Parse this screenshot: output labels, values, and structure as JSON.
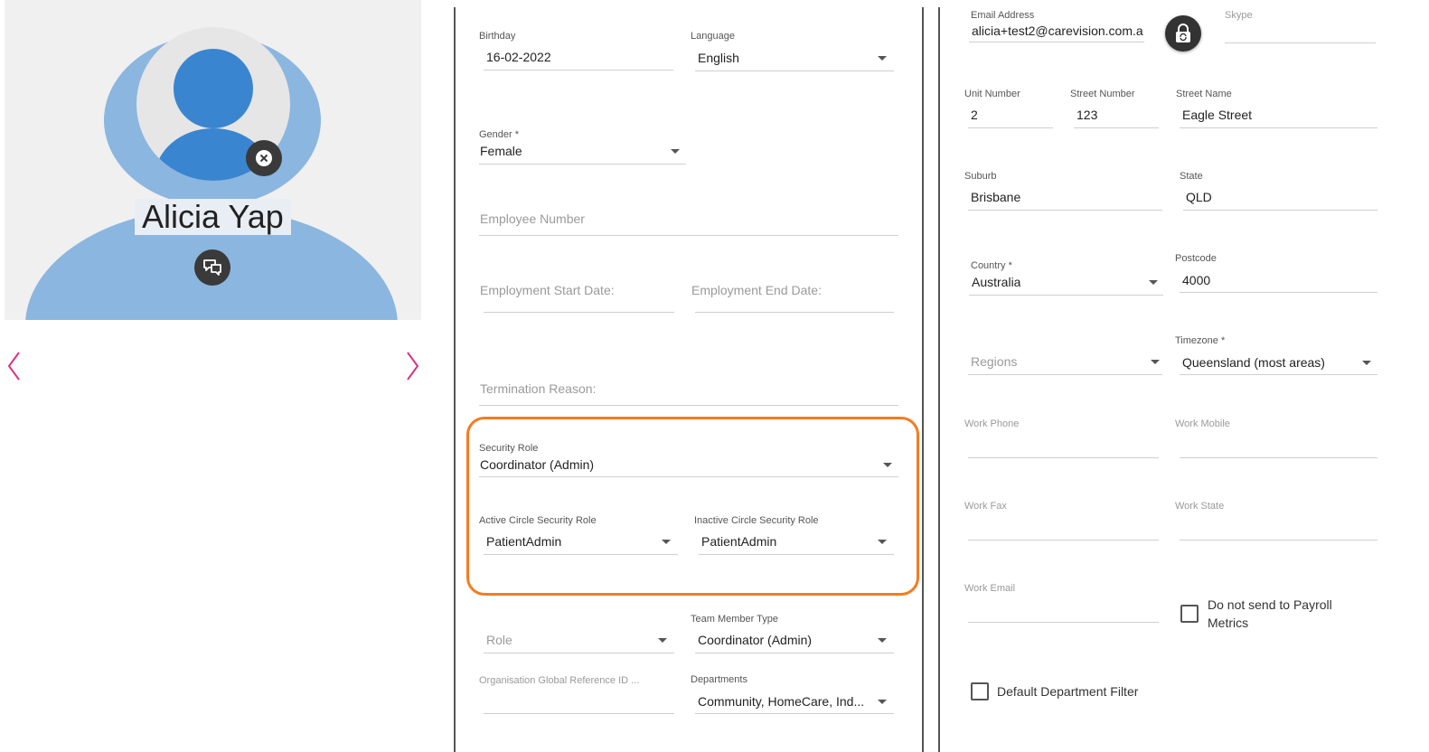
{
  "profile": {
    "name": "Alicia Yap",
    "avatar_icon": "user-avatar-icon",
    "remove_icon": "close-circle-icon",
    "message_icon": "chat-bubbles-icon",
    "nav_prev_icon": "chevron-left-icon",
    "nav_next_icon": "chevron-right-icon"
  },
  "colors": {
    "accent": "#d63384",
    "highlight": "#f57c20",
    "avatar": "#3a85d0",
    "avatar_bg": "#8bb6e0"
  },
  "col1": {
    "birthday": {
      "label": "Birthday",
      "value": "16-02-2022"
    },
    "language": {
      "label": "Language",
      "value": "English"
    },
    "gender": {
      "label": "Gender *",
      "value": "Female"
    },
    "employee_number": {
      "placeholder": "Employee Number"
    },
    "employment_start": {
      "placeholder": "Employment Start Date:"
    },
    "employment_end": {
      "placeholder": "Employment End Date:"
    },
    "termination_reason": {
      "placeholder": "Termination Reason:"
    },
    "security_role": {
      "label": "Security Role",
      "value": "Coordinator (Admin)"
    },
    "active_circle_role": {
      "label": "Active Circle Security Role",
      "value": "PatientAdmin"
    },
    "inactive_circle_role": {
      "label": "Inactive Circle Security Role",
      "value": "PatientAdmin"
    },
    "role": {
      "placeholder": "Role"
    },
    "team_member_type": {
      "label": "Team Member Type",
      "value": "Coordinator (Admin)"
    },
    "org_ref": {
      "label": "Organisation Global Reference ID ..."
    },
    "departments": {
      "label": "Departments",
      "value": "Community, HomeCare, Ind..."
    }
  },
  "col2": {
    "email": {
      "label": "Email Address",
      "value": "alicia+test2@carevision.com.a"
    },
    "skype": {
      "label": "Skype"
    },
    "unit_number": {
      "label": "Unit Number",
      "value": "2"
    },
    "street_number": {
      "label": "Street Number",
      "value": "123"
    },
    "street_name": {
      "label": "Street Name",
      "value": "Eagle Street"
    },
    "suburb": {
      "label": "Suburb",
      "value": "Brisbane"
    },
    "state": {
      "label": "State",
      "value": "QLD"
    },
    "country": {
      "label": "Country *",
      "value": "Australia"
    },
    "postcode": {
      "label": "Postcode",
      "value": "4000"
    },
    "regions": {
      "placeholder": "Regions"
    },
    "timezone": {
      "label": "Timezone *",
      "value": "Queensland (most areas)"
    },
    "work_phone": {
      "label": "Work Phone"
    },
    "work_mobile": {
      "label": "Work Mobile"
    },
    "work_fax": {
      "label": "Work Fax"
    },
    "work_state": {
      "label": "Work State"
    },
    "work_email": {
      "label": "Work Email"
    },
    "payroll_checkbox": {
      "label_line1": "Do not send to Payroll",
      "label_line2": "Metrics",
      "checked": false
    },
    "dept_filter_checkbox": {
      "label": "Default Department Filter",
      "checked": false
    },
    "lock_icon": "lock-refresh-icon"
  }
}
